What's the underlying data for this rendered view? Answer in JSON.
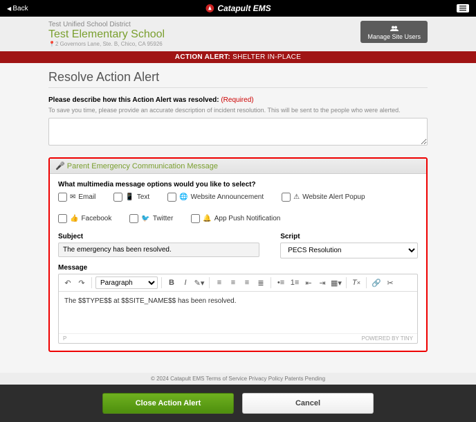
{
  "topbar": {
    "back": "Back",
    "brand": "Catapult EMS"
  },
  "site": {
    "district": "Test Unified School District",
    "school": "Test Elementary School",
    "address": "2 Governors Lane, Ste. B, Chico, CA 95926",
    "manage": "Manage Site Users"
  },
  "alert": {
    "label": "ACTION ALERT:",
    "value": "SHELTER IN-PLACE"
  },
  "page": {
    "title": "Resolve Action Alert",
    "question": "Please describe how this Action Alert was resolved:",
    "required": "(Required)",
    "hint": "To save you time, please provide an accurate description of incident resolution. This will be sent to the people who were alerted."
  },
  "panel": {
    "title": "Parent Emergency Communication Message",
    "opts_q": "What multimedia message options would you like to select?",
    "opts": {
      "email": "Email",
      "text": "Text",
      "wa": "Website Announcement",
      "wap": "Website Alert Popup",
      "fb": "Facebook",
      "tw": "Twitter",
      "push": "App Push Notification"
    },
    "subject_l": "Subject",
    "subject_v": "The emergency has been resolved.",
    "script_l": "Script",
    "script_v": "PECS Resolution",
    "message_l": "Message",
    "para": "Paragraph",
    "body": "The $$TYPE$$ at $$SITE_NAME$$ has been resolved.",
    "p_char": "P",
    "powered": "POWERED BY TINY"
  },
  "footer": {
    "copy": "© 2024 Catapult EMS   Terms of Service   Privacy Policy   Patents Pending",
    "close": "Close Action Alert",
    "cancel": "Cancel"
  }
}
